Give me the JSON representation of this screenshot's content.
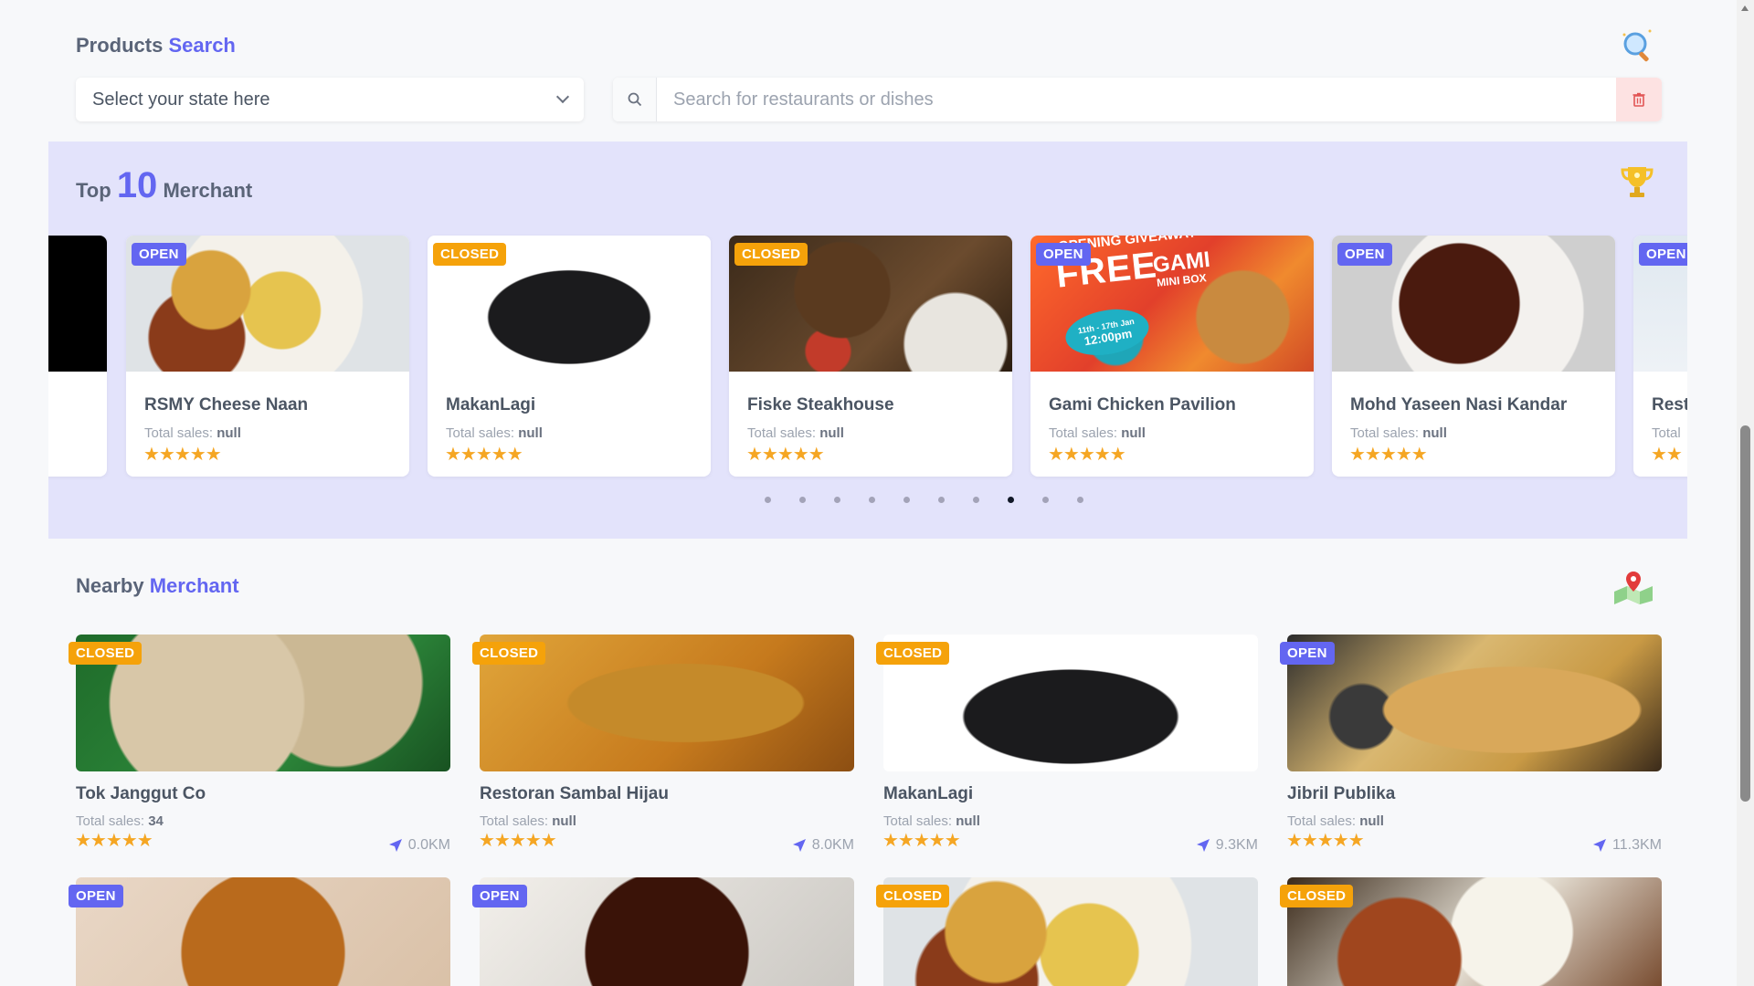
{
  "products_search": {
    "title_part1": "Products",
    "title_part2": "Search",
    "state_select_placeholder": "Select your state here",
    "search_placeholder": "Search for restaurants or dishes"
  },
  "top_merchant": {
    "title_part1": "Top",
    "title_number": "10",
    "title_part2": "Merchant",
    "cards": [
      {
        "status": "OPEN",
        "name": "RSMY Cheese Naan",
        "sales_label": "Total sales:",
        "sales_value": "null",
        "stars": "★★★★★"
      },
      {
        "status": "CLOSED",
        "name": "MakanLagi",
        "sales_label": "Total sales:",
        "sales_value": "null",
        "stars": "★★★★★"
      },
      {
        "status": "CLOSED",
        "name": "Fiske Steakhouse",
        "sales_label": "Total sales:",
        "sales_value": "null",
        "stars": "★★★★★"
      },
      {
        "status": "OPEN",
        "name": "Gami Chicken Pavilion",
        "sales_label": "Total sales:",
        "sales_value": "null",
        "stars": "★★★★★"
      },
      {
        "status": "OPEN",
        "name": "Mohd Yaseen Nasi Kandar",
        "sales_label": "Total sales:",
        "sales_value": "null",
        "stars": "★★★★★"
      },
      {
        "status": "OPEN",
        "name": "Rest",
        "sales_label": "Total",
        "sales_value": "",
        "stars": "★★"
      }
    ],
    "gami_image_text": {
      "line1": "OPENING GIVEAWAY",
      "line2": "FREE",
      "line3": "GAMI",
      "line4": "MINI BOX",
      "line5": "11th - 17th Jan",
      "line6": "12:00pm"
    },
    "dots_count": 10,
    "active_dot": 8
  },
  "nearby_merchant": {
    "title_part1": "Nearby",
    "title_part2": "Merchant",
    "cards": [
      {
        "status": "CLOSED",
        "name": "Tok Janggut Co",
        "sales_label": "Total sales:",
        "sales_value": "34",
        "stars": "★★★★★",
        "distance": "0.0KM"
      },
      {
        "status": "CLOSED",
        "name": "Restoran Sambal Hijau",
        "sales_label": "Total sales:",
        "sales_value": "null",
        "stars": "★★★★★",
        "distance": "8.0KM"
      },
      {
        "status": "CLOSED",
        "name": "MakanLagi",
        "sales_label": "Total sales:",
        "sales_value": "null",
        "stars": "★★★★★",
        "distance": "9.3KM"
      },
      {
        "status": "OPEN",
        "name": "Jibril Publika",
        "sales_label": "Total sales:",
        "sales_value": "null",
        "stars": "★★★★★",
        "distance": "11.3KM"
      },
      {
        "status": "OPEN"
      },
      {
        "status": "OPEN"
      },
      {
        "status": "CLOSED"
      },
      {
        "status": "CLOSED"
      }
    ]
  },
  "colors": {
    "accent": "#6366f1",
    "open": "#6366f1",
    "closed": "#f5a20a",
    "star": "#f5a623",
    "band": "#e3e3fb"
  }
}
